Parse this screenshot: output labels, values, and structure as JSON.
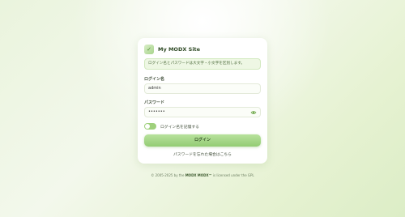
{
  "header": {
    "site_name": "My MODX Site",
    "logo_glyph": "✓"
  },
  "alert": {
    "message": "ログイン名とパスワードは大文字・小文字を区別します。"
  },
  "form": {
    "username_label": "ログイン名",
    "username_value": "admin",
    "password_label": "パスワード",
    "password_value": "•••••••",
    "remember_label": "ログイン名を記憶する",
    "remember_checked": true,
    "login_button": "ログイン",
    "forgot_link": "パスワードを忘れた場合はこちら"
  },
  "footer": {
    "prefix": "© 2005-2025 by the",
    "brand": "MODX",
    "product": "MODX™",
    "suffix": "is licensed under the GPL"
  },
  "colors": {
    "accent": "#9fd07c",
    "background": "#eaf4dd"
  }
}
